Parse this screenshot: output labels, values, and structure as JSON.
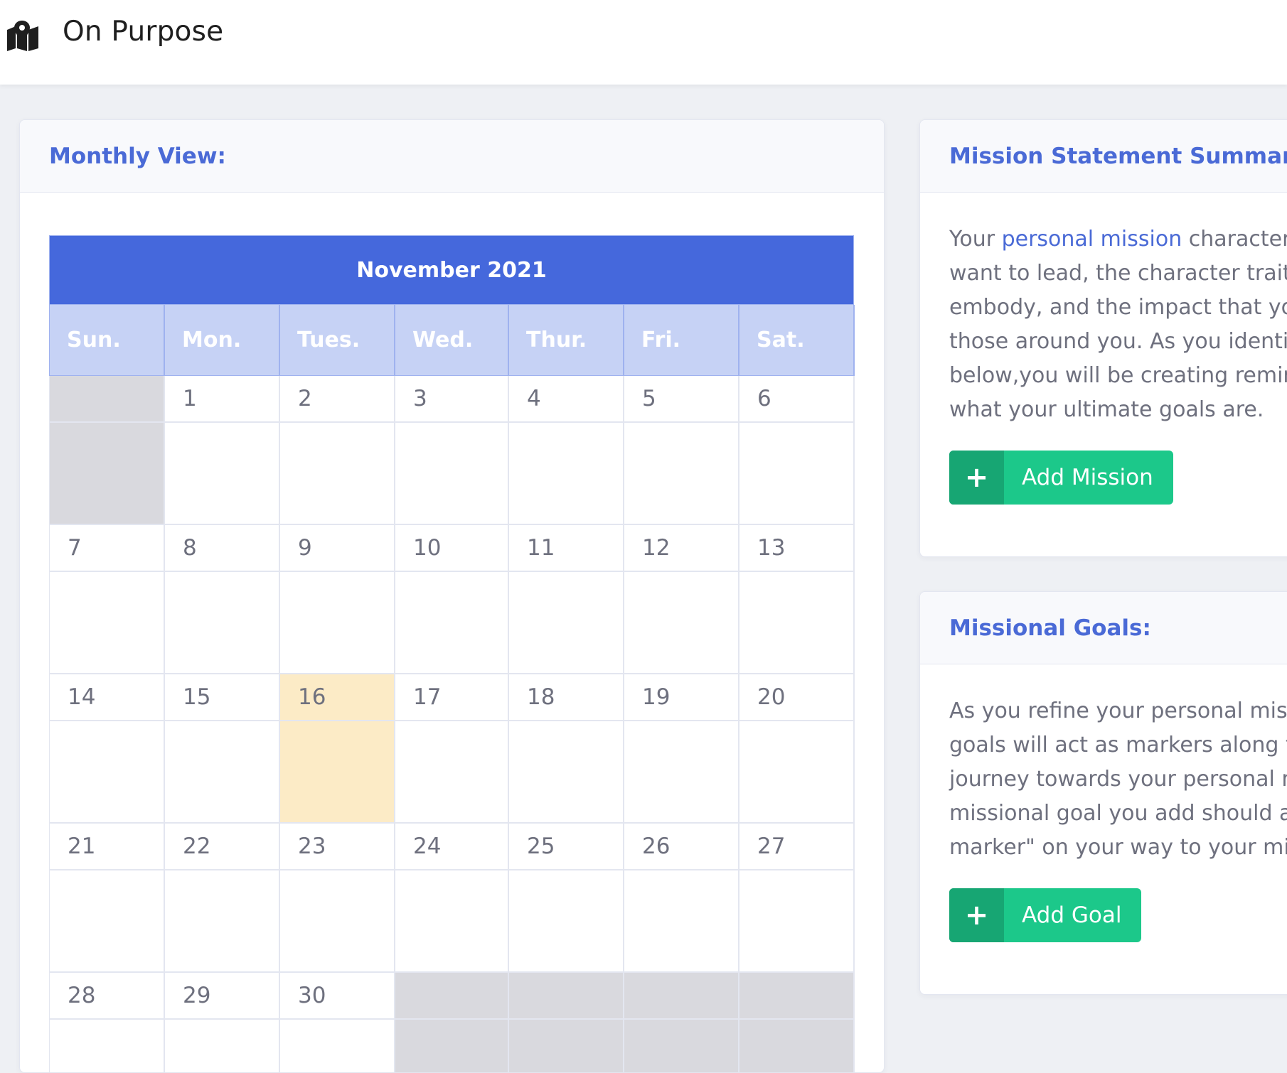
{
  "navbar": {
    "brand_icon": "map-marker-icon",
    "title": "On Purpose"
  },
  "calendar_card": {
    "title": "Monthly View:",
    "month_label": "November 2021",
    "weekdays": [
      "Sun.",
      "Mon.",
      "Tues.",
      "Wed.",
      "Thur.",
      "Fri.",
      "Sat."
    ],
    "weeks": [
      [
        "",
        "1",
        "2",
        "3",
        "4",
        "5",
        "6"
      ],
      [
        "7",
        "8",
        "9",
        "10",
        "11",
        "12",
        "13"
      ],
      [
        "14",
        "15",
        "16",
        "17",
        "18",
        "19",
        "20"
      ],
      [
        "21",
        "22",
        "23",
        "24",
        "25",
        "26",
        "27"
      ],
      [
        "28",
        "29",
        "30",
        "",
        "",
        "",
        ""
      ]
    ],
    "today": "16",
    "colors": {
      "header": "#4568dc",
      "weekday_row": "#c6d2f5",
      "empty_cell": "#d9d9de",
      "today_cell": "#fcebc6"
    }
  },
  "mission_card": {
    "title": "Mission Statement Summary:",
    "text_before_link": "Your ",
    "link": "personal mission",
    "lines": [
      " characteriz",
      "want to lead, the character traits ",
      "embody, and the impact that you ",
      "those around you. As you identify",
      "below,you will be creating remind",
      "what your ultimate goals are."
    ],
    "button": {
      "icon": "plus-icon",
      "label": "Add Mission"
    }
  },
  "goals_card": {
    "title": "Missional Goals:",
    "lines": [
      "As you refine your personal missi",
      "goals will act as markers along th",
      "journey towards your personal mi",
      "missional goal you add should ac",
      "marker\" on your way to your miss"
    ],
    "button": {
      "icon": "plus-icon",
      "label": "Add Goal"
    }
  },
  "accent_colors": {
    "title_blue": "#4a6ad6",
    "success_green": "#1cc88a",
    "success_green_dark": "#17a673"
  }
}
